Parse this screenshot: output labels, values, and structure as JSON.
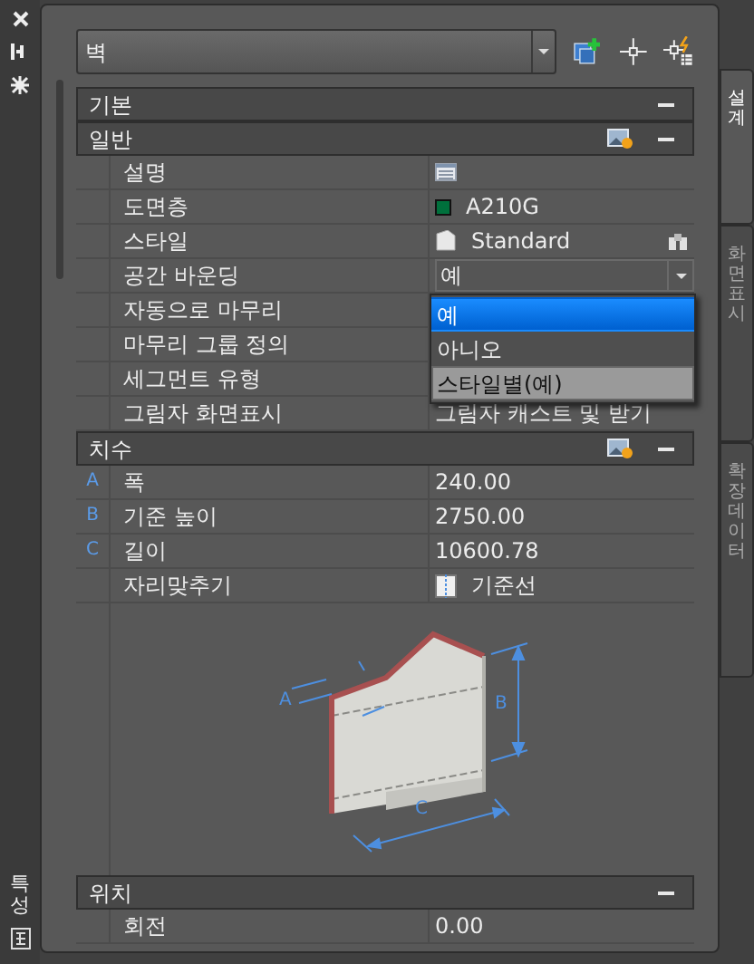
{
  "object_type": {
    "value": "벽"
  },
  "palette_title": "특성",
  "side_tabs": [
    {
      "label": "설계",
      "selected": true
    },
    {
      "label": "화면표시",
      "selected": false
    },
    {
      "label": "확장 데이터",
      "selected": false
    }
  ],
  "sections": [
    {
      "title": "기본",
      "expanded": true,
      "style_icon": false
    },
    {
      "title": "일반",
      "expanded": true,
      "style_icon": true,
      "rows": [
        {
          "label": "설명",
          "kind": "description"
        },
        {
          "label": "도면층",
          "kind": "layer",
          "value": "A210G",
          "color": "#00703c"
        },
        {
          "label": "스타일",
          "kind": "style",
          "value": "Standard"
        },
        {
          "label": "공간 바운딩",
          "kind": "dropdown",
          "value": "예",
          "open": true,
          "options": [
            {
              "label": "예",
              "selected": true,
              "hovered": false
            },
            {
              "label": "아니오",
              "selected": false,
              "hovered": false
            },
            {
              "label": "스타일별(예)",
              "selected": false,
              "hovered": true
            }
          ]
        },
        {
          "label": "자동으로 마무리",
          "kind": "text"
        },
        {
          "label": "마무리 그룹 정의",
          "kind": "text"
        },
        {
          "label": "세그먼트 유형",
          "kind": "text"
        },
        {
          "label": "그림자 화면표시",
          "kind": "text",
          "value": "그림자 캐스트 및 받기"
        }
      ]
    },
    {
      "title": "치수",
      "expanded": true,
      "style_icon": true,
      "rows": [
        {
          "label": "폭",
          "kind": "text",
          "marker": "A",
          "value": "240.00"
        },
        {
          "label": "기준 높이",
          "kind": "text",
          "marker": "B",
          "value": "2750.00"
        },
        {
          "label": "길이",
          "kind": "text",
          "marker": "C",
          "value": "10600.78"
        },
        {
          "label": "자리맞추기",
          "kind": "justify",
          "value": "기준선"
        },
        {
          "kind": "diagram",
          "labels": [
            "A",
            "B",
            "C"
          ]
        }
      ]
    },
    {
      "title": "위치",
      "expanded": true,
      "style_icon": false,
      "rows": [
        {
          "label": "회전",
          "kind": "text",
          "value": "0.00"
        }
      ]
    }
  ]
}
